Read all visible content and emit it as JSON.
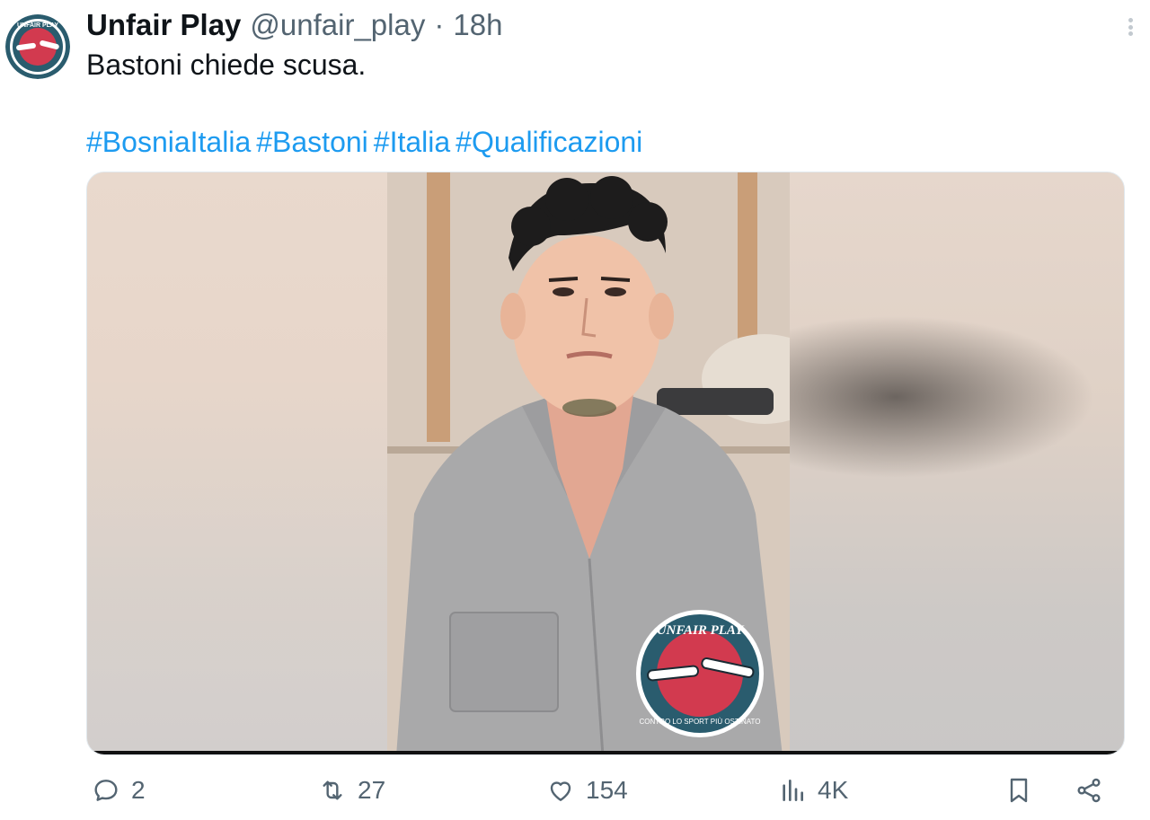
{
  "tweet": {
    "author_name": "Unfair Play",
    "handle": "@unfair_play",
    "separator": "·",
    "time": "18h",
    "text": "Bastoni chiede scusa.",
    "hashtags": [
      "#BosniaItalia",
      "#Bastoni",
      "#Italia",
      "#Qualificazioni"
    ]
  },
  "avatar": {
    "icon": "unfair-play-logo",
    "logo_text_top": "UNFAIR PLAY",
    "logo_text_bottom": "CONTRO LO SPORT PIÙ OSTINATO"
  },
  "media": {
    "watermark_text_top": "UNFAIR PLAY",
    "watermark_text_bottom": "CONTRO LO SPORT PIÙ OSTINATO"
  },
  "actions": {
    "replies": "2",
    "reposts": "27",
    "likes": "154",
    "views": "4K"
  },
  "colors": {
    "accent": "#1d9bf0",
    "secondary_text": "#536471",
    "logo_red": "#d23a4f",
    "logo_teal": "#2a5c6e"
  }
}
